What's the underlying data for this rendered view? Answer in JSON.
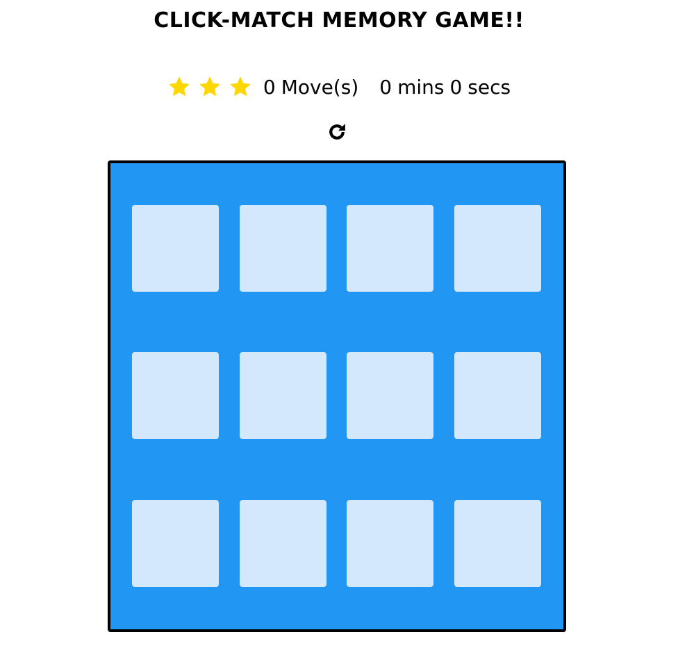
{
  "title": "CLICK-MATCH MEMORY GAME!!",
  "score": {
    "stars": [
      {
        "icon": "star-icon",
        "color": "#ffd700"
      },
      {
        "icon": "star-icon",
        "color": "#ffd700"
      },
      {
        "icon": "star-icon",
        "color": "#ffd700"
      }
    ],
    "moves": "0",
    "moves_label": "Move(s)",
    "minutes": "0",
    "minutes_label": "mins",
    "seconds": "0",
    "seconds_label": "secs"
  },
  "restart": {
    "icon": "restart-icon"
  },
  "deck": {
    "colors": {
      "background": "#2196f3",
      "card": "#d4e8fb",
      "border": "#000000"
    },
    "card_count": 12
  }
}
